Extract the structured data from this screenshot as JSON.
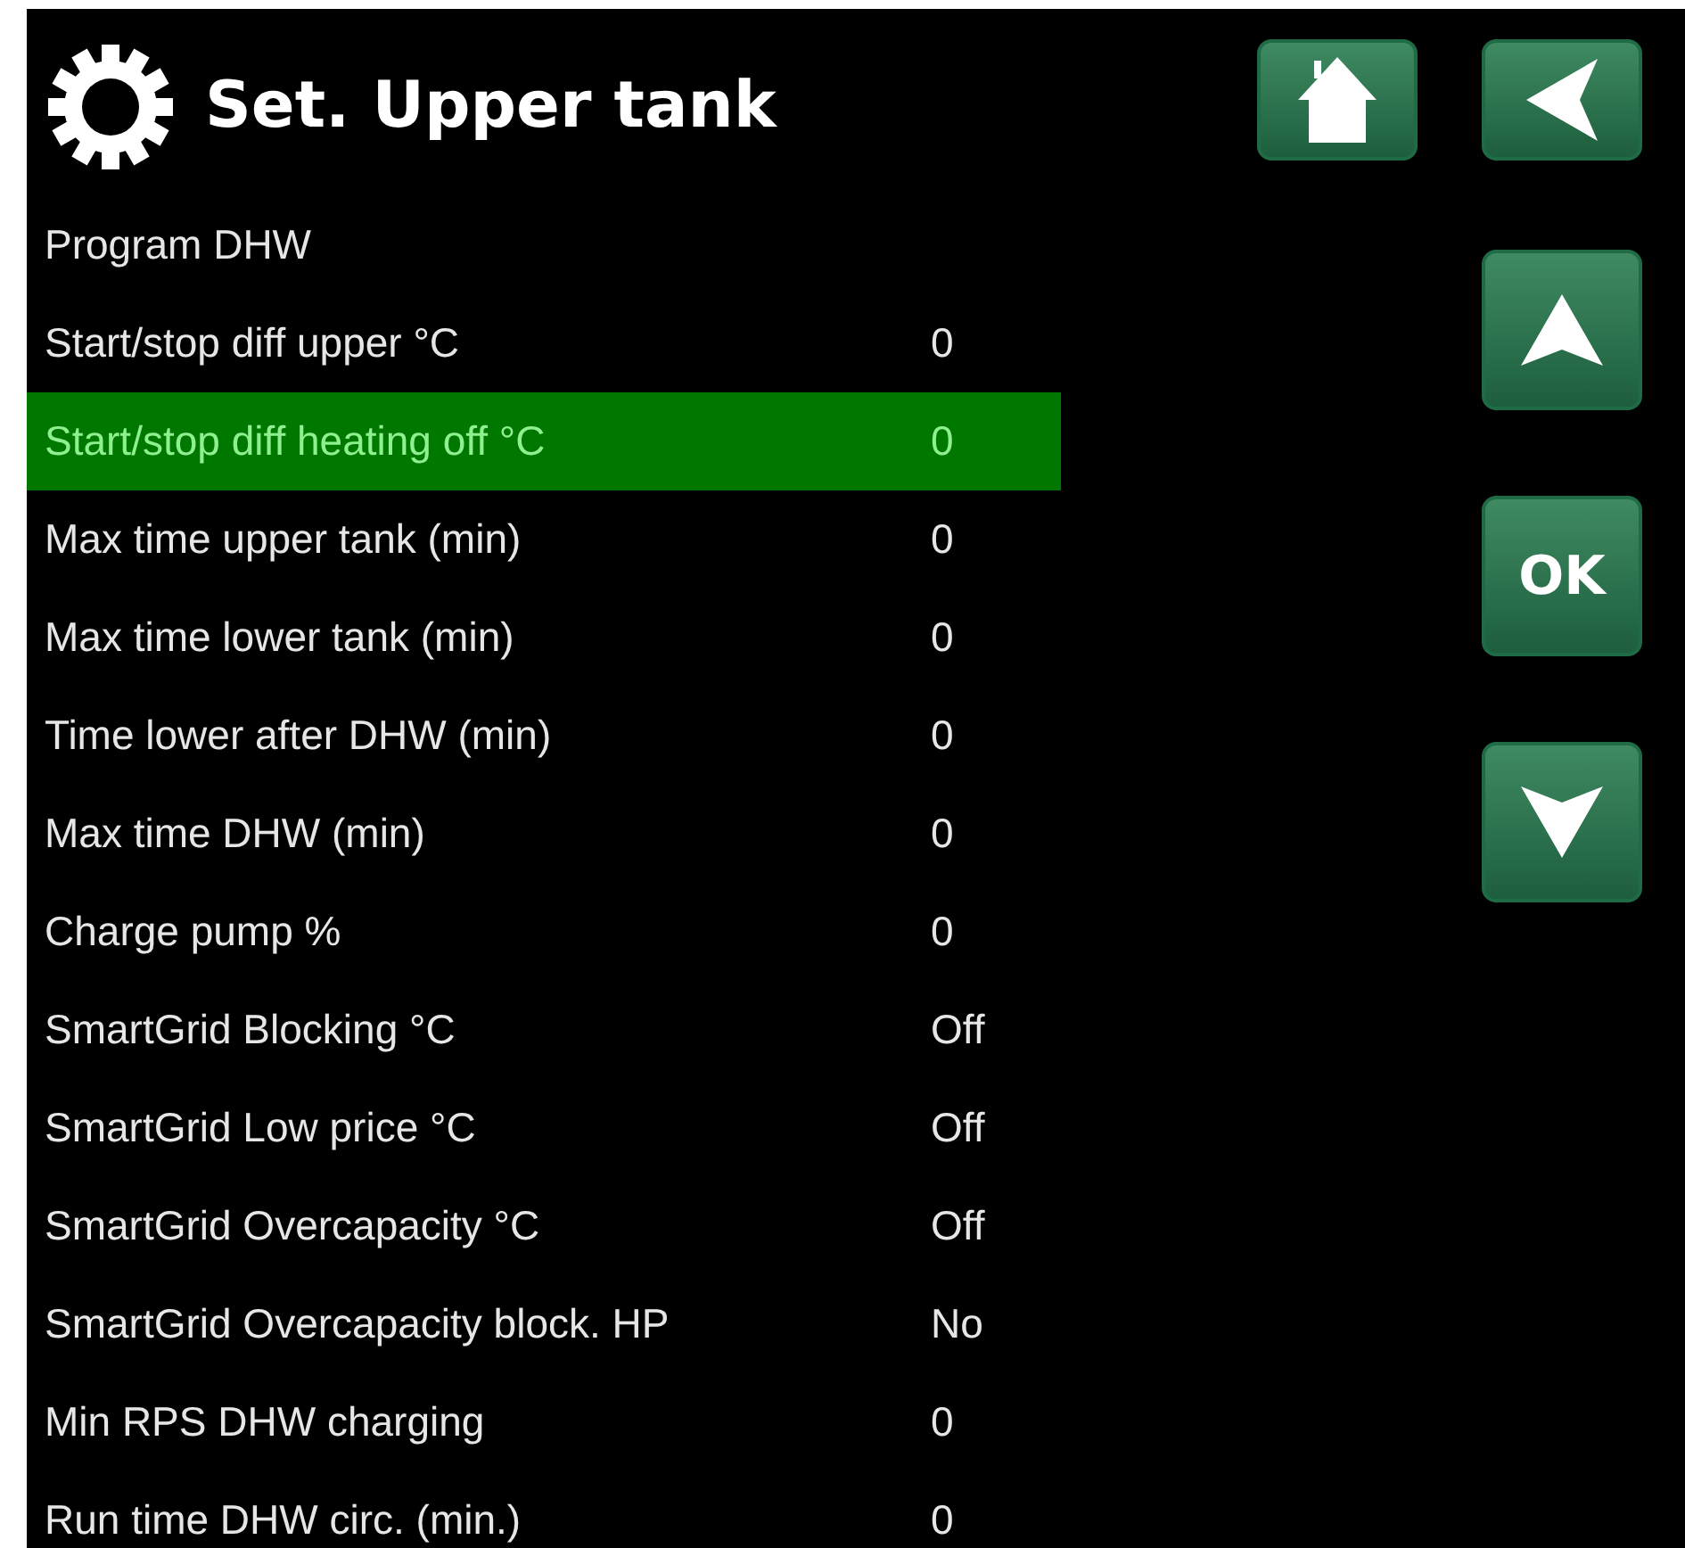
{
  "header": {
    "title": "Set. Upper tank"
  },
  "top_buttons": [
    {
      "kind": "home"
    },
    {
      "kind": "back"
    }
  ],
  "side_buttons": [
    {
      "kind": "up"
    },
    {
      "kind": "ok",
      "label": "OK"
    },
    {
      "kind": "down"
    }
  ],
  "rows": [
    {
      "label": "Program DHW",
      "selected": false
    },
    {
      "label": "Start/stop diff upper °C",
      "value": "0",
      "selected": false
    },
    {
      "label": "Start/stop diff heating off °C",
      "value": "0",
      "selected": true
    },
    {
      "label": "Max time upper tank (min)",
      "value": "0",
      "selected": false
    },
    {
      "label": "Max time lower tank (min)",
      "value": "0",
      "selected": false
    },
    {
      "label": "Time lower after DHW (min)",
      "value": "0",
      "selected": false
    },
    {
      "label": "Max time DHW (min)",
      "value": "0",
      "selected": false
    },
    {
      "label": "Charge pump %",
      "value": "0",
      "selected": false
    },
    {
      "label": "SmartGrid Blocking °C",
      "value": "Off",
      "selected": false
    },
    {
      "label": "SmartGrid Low price °C",
      "value": "Off",
      "selected": false
    },
    {
      "label": "SmartGrid Overcapacity °C",
      "value": "Off",
      "selected": false
    },
    {
      "label": "SmartGrid Overcapacity block. HP",
      "value": "No",
      "selected": false
    },
    {
      "label": "Min RPS DHW charging",
      "value": "0",
      "selected": false
    },
    {
      "label": "Run time DHW circ. (min.)",
      "value": "0",
      "selected": false
    }
  ]
}
